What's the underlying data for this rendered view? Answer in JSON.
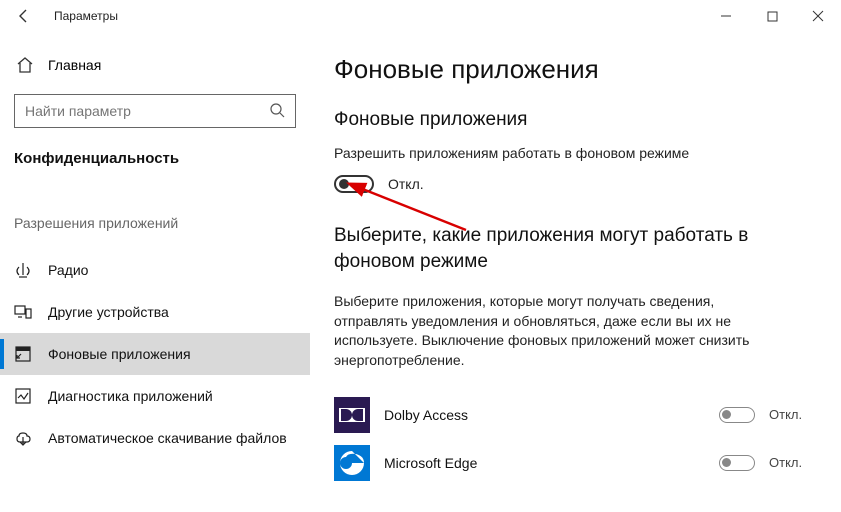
{
  "window": {
    "title": "Параметры"
  },
  "sidebar": {
    "home_label": "Главная",
    "search_placeholder": "Найти параметр",
    "category_label": "Конфиденциальность",
    "group_label": "Разрешения приложений",
    "items": [
      {
        "label": "Радио"
      },
      {
        "label": "Другие устройства"
      },
      {
        "label": "Фоновые приложения"
      },
      {
        "label": "Диагностика приложений"
      },
      {
        "label": "Автоматическое скачивание файлов"
      }
    ]
  },
  "main": {
    "page_title": "Фоновые приложения",
    "section1_title": "Фоновые приложения",
    "allow_label": "Разрешить приложениям работать в фоновом режиме",
    "allow_state": "Откл.",
    "section2_title": "Выберите, какие приложения могут работать в фоновом режиме",
    "description": "Выберите приложения, которые могут получать сведения, отправлять уведомления и обновляться, даже если вы их не используете. Выключение фоновых приложений может снизить энергопотребление.",
    "apps": [
      {
        "name": "Dolby Access",
        "state": "Откл."
      },
      {
        "name": "Microsoft Edge",
        "state": "Откл."
      }
    ]
  }
}
